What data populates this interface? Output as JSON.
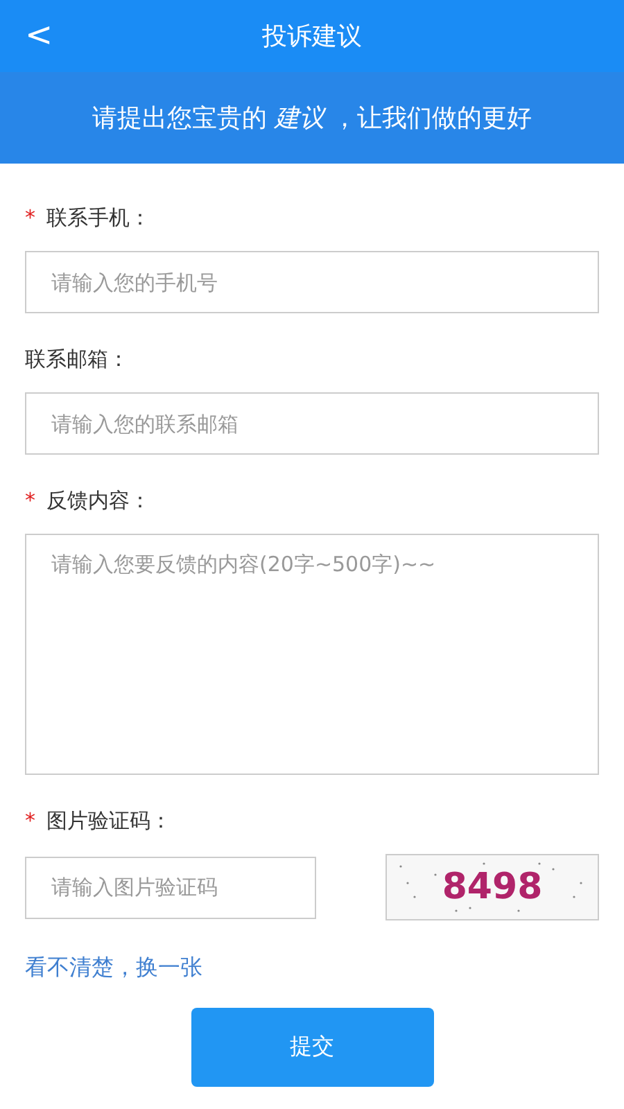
{
  "header": {
    "back": "<",
    "title": "投诉建议"
  },
  "banner": {
    "text": "请提出您宝贵的 *建议* ，让我们做的更好"
  },
  "fields": [
    {
      "kind": "input",
      "label": "联系手机：",
      "required": true,
      "placeholder": "请输入您的手机号"
    },
    {
      "kind": "input",
      "label": "联系邮箱：",
      "required": false,
      "placeholder": "请输入您的联系邮箱"
    },
    {
      "kind": "textarea",
      "label": "反馈内容：",
      "required": true,
      "placeholder": "请输入您要反馈的内容(20字~500字)~~"
    }
  ],
  "captcha": {
    "label": "图片验证码：",
    "required": true,
    "placeholder": "请输入图片验证码",
    "code": "8498",
    "refresh_link": "看不清楚，换一张"
  },
  "required_mark": "*",
  "submit": "提交"
}
